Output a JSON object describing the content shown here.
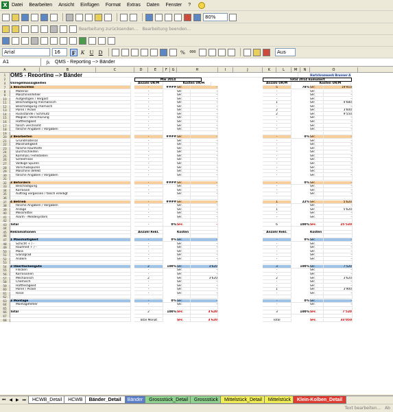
{
  "menu": {
    "items": [
      "Datei",
      "Bearbeiten",
      "Ansicht",
      "Einfügen",
      "Format",
      "Extras",
      "Daten",
      "Fenster",
      "?"
    ]
  },
  "toolbar": {
    "zoom": "80%",
    "ghost1": "Bearbeitung zurücksenden...",
    "ghost2": "Bearbeitung beenden..."
  },
  "format": {
    "font": "Arial",
    "size": "16",
    "bold": "F",
    "italic": "K",
    "underline": "U",
    "strike": "D",
    "percent": "%",
    "thousands": "000",
    "find": "Aus"
  },
  "formula": {
    "cell": "A1",
    "fx": "fx",
    "content": "QMS - Reporting --> Bänder"
  },
  "columns": [
    "A",
    "B",
    "C",
    "D",
    "E",
    "F",
    "G",
    "H",
    "I",
    "J",
    "K",
    "L",
    "M",
    "N",
    "O"
  ],
  "sheet": {
    "title": "QMS - Reporting --> Bänder",
    "logo": "Hartchromwerk Brunner AG",
    "month": "Mai 2014",
    "total_label": "Total 2014 kumuliert",
    "hdr_unreg": "Unregelmässigkeiten",
    "hdr_anzahl": "Anzahl UR/M",
    "hdr_kosten": "Kosten UR/M",
    "hdr_reklam": "Reklamationen",
    "hdr_anzrek": "Anzahl Rekl.",
    "hdr_kosrek": "Kosten Rekl.",
    "rows": [
      {
        "n": "7",
        "b": "1  Beschichten",
        "d": "-",
        "e": "",
        "g": "####",
        "h": "SFr.",
        "hv": "-",
        "k": "5",
        "m": "78%",
        "o": "SFr.",
        "ov": "19'910",
        "cls": "sec"
      },
      {
        "n": "8",
        "b": "Material",
        "d": "-",
        "h": "SFr.",
        "hv": "-",
        "k": "-",
        "o": "SFr.",
        "ov": "-"
      },
      {
        "n": "9",
        "b": "Maschinenfehler",
        "d": "-",
        "h": "SFr.",
        "hv": "-",
        "k": "-",
        "o": "SFr.",
        "ov": "-"
      },
      {
        "n": "10",
        "b": "Aufgestigen / Vergast",
        "d": "-",
        "h": "SFr.",
        "hv": "-",
        "k": "-",
        "o": "SFr.",
        "ov": "-"
      },
      {
        "n": "11",
        "b": "Beschädigung mechanisch",
        "d": "-",
        "h": "SFr.",
        "hv": "-",
        "k": "1",
        "o": "SFr.",
        "ov": "4'680"
      },
      {
        "n": "12",
        "b": "Beschädigung chemisch",
        "d": "-",
        "h": "SFr.",
        "hv": "-",
        "k": "-",
        "o": "SFr.",
        "ov": "-"
      },
      {
        "n": "13",
        "b": "Poren / Pickel",
        "d": "-",
        "h": "SFr.",
        "hv": "-",
        "k": "2",
        "o": "SFr.",
        "ov": "3'600"
      },
      {
        "n": "14",
        "b": "Rückstände / Schmutz",
        "d": "-",
        "h": "SFr.",
        "hv": "-",
        "k": "2",
        "o": "SFr.",
        "ov": "9'550"
      },
      {
        "n": "15",
        "b": "Mögliel / Verschlurung",
        "d": "-",
        "h": "SFr.",
        "hv": "-",
        "k": "-",
        "o": "SFr.",
        "ov": "-"
      },
      {
        "n": "16",
        "b": "Haftfestigkeit",
        "d": "-",
        "h": "SFr.",
        "hv": "-",
        "k": "-",
        "o": "SFr.",
        "ov": "-"
      },
      {
        "n": "17",
        "b": "falsch verchromt",
        "d": "-",
        "h": "SFr.",
        "hv": "-",
        "k": "-",
        "o": "SFr.",
        "ov": "-"
      },
      {
        "n": "18",
        "b": "falsche Angaben / Vorgaben",
        "d": "-",
        "h": "SFr.",
        "hv": "-",
        "k": "-",
        "o": "SFr.",
        "ov": "-"
      },
      {
        "n": "19",
        "b": "",
        "d": "",
        "h": "",
        "hv": "",
        "k": "",
        "o": "",
        "ov": ""
      },
      {
        "n": "20",
        "b": "2  Bearbeiten",
        "d": "-",
        "g": "####",
        "h": "SFr.",
        "hv": "-",
        "k": "-",
        "m": "0%",
        "o": "SFr.",
        "ov": "-",
        "cls": "sec"
      },
      {
        "n": "21",
        "b": "Grundmaterial",
        "d": "-",
        "h": "SFr.",
        "hv": "-",
        "k": "-",
        "o": "SFr.",
        "ov": "-"
      },
      {
        "n": "22",
        "b": "Masshaltigkeit",
        "d": "-",
        "h": "SFr.",
        "hv": "-",
        "k": "-",
        "o": "SFr.",
        "ov": "-"
      },
      {
        "n": "23",
        "b": "falsche Rauhtiefe",
        "d": "-",
        "h": "SFr.",
        "hv": "-",
        "k": "-",
        "o": "SFr.",
        "ov": "-"
      },
      {
        "n": "24",
        "b": "Durchschleifen",
        "d": "-",
        "h": "SFr.",
        "hv": "-",
        "k": "-",
        "o": "SFr.",
        "ov": "-"
      },
      {
        "n": "25",
        "b": "Kommas / Fehlstellen",
        "d": "-",
        "h": "SFr.",
        "hv": "-",
        "k": "-",
        "o": "SFr.",
        "ov": "-"
      },
      {
        "n": "26",
        "b": "Schleifrisse",
        "d": "-",
        "h": "SFr.",
        "hv": "-",
        "k": "-",
        "o": "SFr.",
        "ov": "-"
      },
      {
        "n": "27",
        "b": "Vollkige Spuren",
        "d": "-",
        "h": "SFr.",
        "hv": "-",
        "k": "-",
        "o": "SFr.",
        "ov": "-"
      },
      {
        "n": "28",
        "b": "Vorschubspuren",
        "d": "-",
        "h": "SFr.",
        "hv": "-",
        "k": "-",
        "o": "SFr.",
        "ov": "-"
      },
      {
        "n": "29",
        "b": "Maschine defekt",
        "d": "-",
        "h": "SFr.",
        "hv": "-",
        "k": "-",
        "o": "SFr.",
        "ov": "-"
      },
      {
        "n": "30",
        "b": "falsche Angaben / Vorgaben",
        "d": "-",
        "h": "SFr.",
        "hv": "-",
        "k": "-",
        "o": "SFr.",
        "ov": "-"
      },
      {
        "n": "31",
        "b": "",
        "d": "",
        "h": "",
        "hv": "",
        "k": "",
        "o": "",
        "ov": ""
      },
      {
        "n": "32",
        "b": "3  Befördern",
        "d": "-",
        "g": "####",
        "h": "SFr.",
        "hv": "-",
        "k": "-",
        "m": "0%",
        "o": "SFr.",
        "ov": "-",
        "cls": "sec"
      },
      {
        "n": "33",
        "b": "Beschädigung",
        "d": "-",
        "h": "SFr.",
        "hv": "-",
        "k": "-",
        "o": "SFr.",
        "ov": "-"
      },
      {
        "n": "34",
        "b": "Korrosion",
        "d": "-",
        "h": "SFr.",
        "hv": "-",
        "k": "-",
        "o": "SFr.",
        "ov": "-"
      },
      {
        "n": "35",
        "b": "Auftrag vergessen / falsch erledigt",
        "d": "-",
        "h": "SFr.",
        "hv": "-",
        "k": "-",
        "o": "SFr.",
        "ov": "-"
      },
      {
        "n": "36",
        "b": "",
        "d": "",
        "h": "",
        "hv": "",
        "k": "",
        "o": "",
        "ov": ""
      },
      {
        "n": "37",
        "b": "4  Betrieb",
        "d": "-",
        "g": "####",
        "h": "SFr.",
        "hv": "-",
        "k": "1",
        "m": "22%",
        "o": "SFr.",
        "ov": "5'620",
        "cls": "sec"
      },
      {
        "n": "38",
        "b": "falsche Angaben / Vorgaben",
        "d": "-",
        "h": "SFr.",
        "hv": "-",
        "k": "-",
        "o": "SFr.",
        "ov": "-"
      },
      {
        "n": "39",
        "b": "Anlage",
        "d": "-",
        "h": "SFr.",
        "hv": "-",
        "k": "1",
        "o": "SFr.",
        "ov": "5'620"
      },
      {
        "n": "40",
        "b": "Messmittel",
        "d": "-",
        "h": "SFr.",
        "hv": "-",
        "k": "-",
        "o": "SFr.",
        "ov": "-"
      },
      {
        "n": "41",
        "b": "Alarm - Meldesystem",
        "d": "-",
        "h": "SFr.",
        "hv": "-",
        "k": "-",
        "o": "SFr.",
        "ov": "-"
      },
      {
        "n": "42",
        "b": "",
        "d": "",
        "h": "",
        "hv": "",
        "k": "",
        "o": "",
        "ov": ""
      },
      {
        "n": "43",
        "b": "Total",
        "d": "-",
        "g": "0%",
        "h": "SFr.",
        "hv": "-",
        "k": "6",
        "m": "100%",
        "o": "SFr.",
        "ov": "25'530",
        "cls": "tot"
      },
      {
        "n": "44",
        "b": "",
        "d": "",
        "h": "",
        "hv": "",
        "k": "",
        "o": "",
        "ov": ""
      },
      {
        "n": "45",
        "b": "Reklamationen",
        "d": "Anzahl Rekl.",
        "h": "Kosten Rekl.",
        "hv": "",
        "k": "Anzahl Rekl.",
        "o": "Kosten Rekl.",
        "ov": "",
        "cls": "hdr"
      },
      {
        "n": "46",
        "b": "",
        "d": "",
        "h": "",
        "hv": "",
        "k": "",
        "o": "",
        "ov": ""
      },
      {
        "n": "47",
        "b": "1  Masshaltigkeit",
        "d": "-",
        "g": "0%",
        "h": "SFr.",
        "hv": "-",
        "k": "-",
        "m": "0%",
        "o": "SFr.",
        "ov": "-",
        "cls": "sec2"
      },
      {
        "n": "48",
        "b": "Schicht + / -",
        "d": "-",
        "h": "SFr.",
        "hv": "-",
        "k": "-",
        "o": "SFr.",
        "ov": "-"
      },
      {
        "n": "49",
        "b": "Rauhheit + / -",
        "d": "-",
        "h": "SFr.",
        "hv": "-",
        "k": "-",
        "o": "SFr.",
        "ov": "-"
      },
      {
        "n": "50",
        "b": "Mass",
        "d": "-",
        "h": "SFr.",
        "hv": "-",
        "k": "-",
        "o": "SFr.",
        "ov": "-"
      },
      {
        "n": "51",
        "b": "Glanzgrad",
        "d": "-",
        "h": "SFr.",
        "hv": "-",
        "k": "-",
        "o": "SFr.",
        "ov": "-"
      },
      {
        "n": "52",
        "b": "Andere",
        "d": "-",
        "h": "SFr.",
        "hv": "-",
        "k": "-",
        "o": "SFr.",
        "ov": "-"
      },
      {
        "n": "53",
        "b": "",
        "d": "",
        "h": "",
        "hv": "",
        "k": "",
        "o": "",
        "ov": ""
      },
      {
        "n": "54",
        "b": "2  Oberflächengüte",
        "d": "2",
        "g": "100%",
        "h": "SFr.",
        "hv": "3'620",
        "k": "3",
        "m": "100%",
        "o": "SFr.",
        "ov": "7'520",
        "cls": "sec2"
      },
      {
        "n": "55",
        "b": "Flecken",
        "d": "-",
        "h": "SFr.",
        "hv": "-",
        "k": "-",
        "o": "SFr.",
        "ov": "-"
      },
      {
        "n": "56",
        "b": "Korrosionen",
        "d": "-",
        "h": "SFr.",
        "hv": "-",
        "k": "-",
        "o": "SFr.",
        "ov": "-"
      },
      {
        "n": "57",
        "b": "Mechanisch",
        "d": "2",
        "h": "SFr.",
        "hv": "3'620",
        "k": "2",
        "o": "SFr.",
        "ov": "3'620"
      },
      {
        "n": "58",
        "b": "Chemisch",
        "d": "-",
        "h": "SFr.",
        "hv": "-",
        "k": "-",
        "o": "SFr.",
        "ov": "-"
      },
      {
        "n": "59",
        "b": "Haftfestigkeit",
        "d": "-",
        "h": "SFr.",
        "hv": "-",
        "k": "-",
        "o": "SFr.",
        "ov": "-"
      },
      {
        "n": "60",
        "b": "Poren / Pickel",
        "d": "-",
        "h": "SFr.",
        "hv": "-",
        "k": "1",
        "o": "SFr.",
        "ov": "3'900"
      },
      {
        "n": "61",
        "b": "Risse",
        "d": "-",
        "h": "SFr.",
        "hv": "-",
        "k": "-",
        "o": "SFr.",
        "ov": "-"
      },
      {
        "n": "62",
        "b": "",
        "d": "",
        "h": "",
        "hv": "",
        "k": "",
        "o": "",
        "ov": ""
      },
      {
        "n": "63",
        "b": "3  Montage",
        "d": "-",
        "g": "0%",
        "h": "SFr.",
        "hv": "-",
        "k": "-",
        "m": "0%",
        "o": "SFr.",
        "ov": "-",
        "cls": "sec2"
      },
      {
        "n": "64",
        "b": "Montagefehler",
        "d": "-",
        "h": "SFr.",
        "hv": "-",
        "k": "-",
        "o": "SFr.",
        "ov": "-"
      },
      {
        "n": "65",
        "b": "",
        "d": "",
        "h": "",
        "hv": "",
        "k": "",
        "o": "",
        "ov": ""
      },
      {
        "n": "66",
        "b": "Total",
        "d": "2",
        "g": "100%",
        "h": "SFr.",
        "hv": "3'620",
        "k": "3",
        "m": "100%",
        "o": "SFr.",
        "ov": "7'520",
        "cls": "tot"
      },
      {
        "n": "67",
        "b": "",
        "d": "",
        "h": "",
        "hv": "",
        "k": "",
        "o": "",
        "ov": ""
      },
      {
        "n": "68",
        "b": "",
        "d": "Total Monat",
        "h": "SFr.",
        "hv": "3'620",
        "k": "Total",
        "o": "SFr.",
        "ov": "33'050",
        "cls": "tot"
      }
    ]
  },
  "tabs": {
    "items": [
      {
        "label": "HCWB_Detail",
        "cls": ""
      },
      {
        "label": "HCWB",
        "cls": ""
      },
      {
        "label": "Bänder_Detail",
        "cls": "active"
      },
      {
        "label": "Bänder",
        "cls": "blue"
      },
      {
        "label": "Grossstück_Detail",
        "cls": "green"
      },
      {
        "label": "Grossstück",
        "cls": "green"
      },
      {
        "label": "Mittelstück_Detail",
        "cls": "yellow"
      },
      {
        "label": "Mittelstück",
        "cls": "yellow"
      },
      {
        "label": "Klein-Kolben_Detail",
        "cls": "red"
      }
    ]
  },
  "status": {
    "text": "Text bearbeiten...",
    "extra": "Ab"
  }
}
